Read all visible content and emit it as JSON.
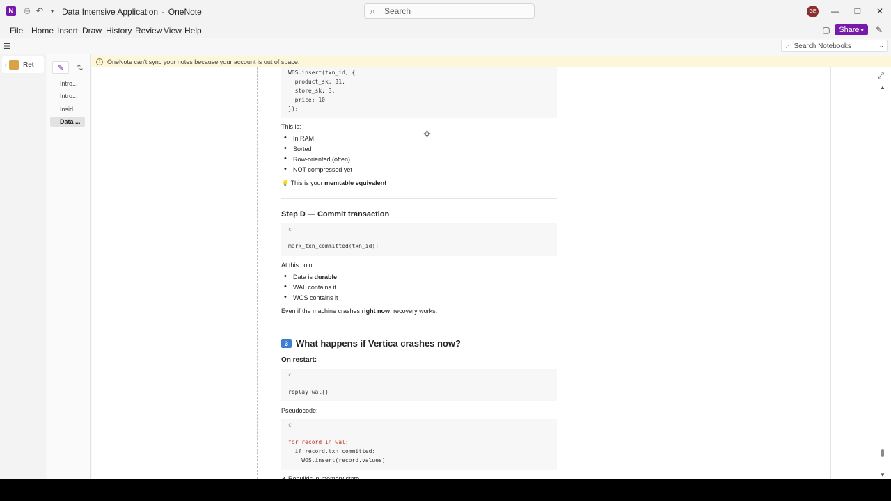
{
  "window": {
    "title": "Data Intensive Application",
    "app_name": "OneNote",
    "title_separator": "-",
    "search_placeholder": "Search",
    "avatar_initials": "GE"
  },
  "menu": [
    "File",
    "Home",
    "Insert",
    "Draw",
    "History",
    "Review",
    "View",
    "Help"
  ],
  "share_label": "Share",
  "notebook_search_placeholder": "Search Notebooks",
  "notebook": {
    "label": "Ret"
  },
  "pages": [
    "Intro...",
    "Intro...",
    "Insid...",
    "Data ..."
  ],
  "notice": "OneNote can't sync your notes because your account is out of space.",
  "content": {
    "code1": [
      "WOS.insert(txn_id, {",
      "  product_sk: 31,",
      "  store_sk: 3,",
      "  price: 10",
      "});"
    ],
    "this_is": "This is:",
    "props": [
      "In RAM",
      "Sorted",
      "Row-oriented (often)",
      "NOT compressed yet"
    ],
    "tip_prefix": "This is your ",
    "tip_bold": "memtable equivalent",
    "step_d": "Step D — Commit transaction",
    "code2_tick": "c",
    "code2": "mark_txn_committed(txn_id);",
    "at_this_point": "At this point:",
    "point1_prefix": "Data is ",
    "point1_bold": "durable",
    "point2": "WAL contains it",
    "point3": "WOS contains it",
    "crash_prefix": "Even if the machine crashes ",
    "crash_bold": "right now",
    "crash_suffix": ", recovery works.",
    "section3_badge": "3",
    "section3_title": "What happens if Vertica crashes now?",
    "on_restart": "On restart:",
    "code3_tick": "c",
    "code3": "replay_wal()",
    "pseudocode": "Pseudocode:",
    "code4_tick": "c",
    "code4": [
      "for record in wal:",
      "  if record.txn_committed:",
      "    WOS.insert(record.values)"
    ],
    "cut_off": "✔ Rebuilds in-memory state"
  }
}
